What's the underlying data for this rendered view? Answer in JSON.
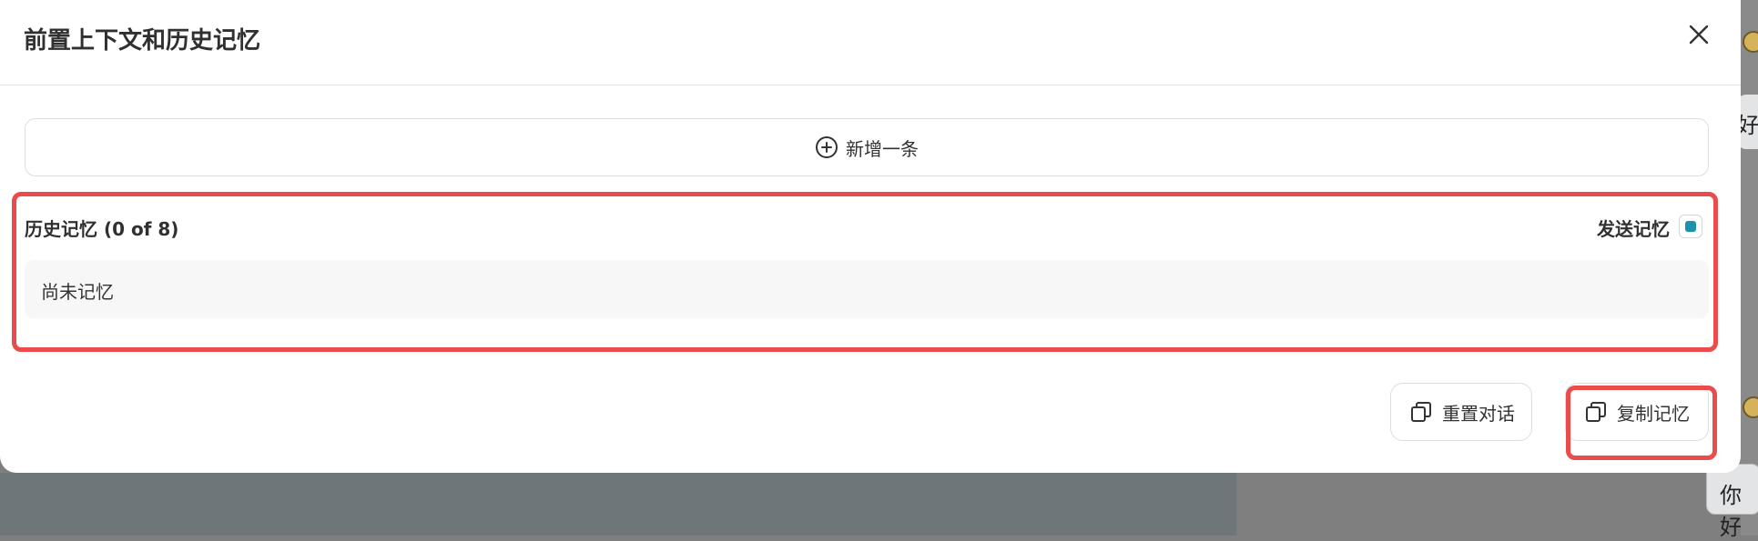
{
  "modal": {
    "title": "前置上下文和历史记忆",
    "add_button_label": "新增一条"
  },
  "memory": {
    "title": "历史记忆 (0 of 8)",
    "send_label": "发送记忆",
    "send_checked": true,
    "empty_text": "尚未记忆"
  },
  "actions": {
    "reset_label": "重置对话",
    "copy_label": "复制记忆"
  },
  "background": {
    "bubble_text": "你好",
    "bubble_partial_text": "好"
  },
  "colors": {
    "accent": "#1d93ab",
    "highlight": "#ea4c4c",
    "overlay": "#7f7f80"
  }
}
